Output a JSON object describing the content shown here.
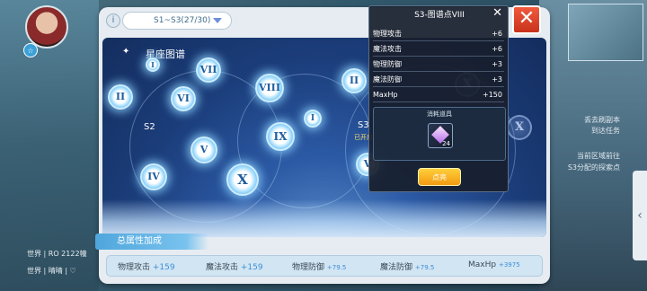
{
  "world": {
    "chat_lines": [
      "世界 | RO 2122幢",
      "世界 | 晴晴 | ♡"
    ],
    "right_labels": [
      "丢去刷副本",
      "到达任务",
      "当前区域前往",
      "S3分配的探索点"
    ]
  },
  "toolbar": {
    "segment_value": "S1~S3(27/30)"
  },
  "star_field": {
    "title": "星座图谱",
    "segment_labels": [
      "S2",
      "S3"
    ],
    "segment_sub": "已开启",
    "nodes": [
      {
        "label": "I",
        "active": true
      },
      {
        "label": "II",
        "active": true
      },
      {
        "label": "VI",
        "active": true
      },
      {
        "label": "VII",
        "active": true
      },
      {
        "label": "VIII",
        "active": true
      },
      {
        "label": "II",
        "active": true
      },
      {
        "label": "I",
        "active": true
      },
      {
        "label": "IX",
        "active": true
      },
      {
        "label": "V",
        "active": true
      },
      {
        "label": "IV",
        "active": true
      },
      {
        "label": "X",
        "active": true
      },
      {
        "label": "X",
        "active": false
      },
      {
        "label": "X",
        "active": false
      },
      {
        "label": "V",
        "active": true
      }
    ]
  },
  "popup": {
    "title": "S3-图谱点VIII",
    "stats": [
      {
        "name": "物理攻击",
        "value": "+6"
      },
      {
        "name": "魔法攻击",
        "value": "+6"
      },
      {
        "name": "物理防御",
        "value": "+3"
      },
      {
        "name": "魔法防御",
        "value": "+3"
      },
      {
        "name": "MaxHp",
        "value": "+150"
      }
    ],
    "consume_title": "消耗道具",
    "item_count": "24",
    "confirm_label": "点亮"
  },
  "totals": {
    "tab_label": "总属性加成",
    "stats": [
      {
        "name": "物理攻击",
        "value": "+159"
      },
      {
        "name": "魔法攻击",
        "value": "+159"
      },
      {
        "name": "物理防御",
        "value": "+79.5"
      },
      {
        "name": "魔法防御",
        "value": "+79.5"
      },
      {
        "name": "MaxHp",
        "value": "+3975"
      }
    ]
  },
  "colors": {
    "accent_blue": "#3b8fd6",
    "close_red": "#e24a2c",
    "button_yellow": "#f7b42a"
  }
}
